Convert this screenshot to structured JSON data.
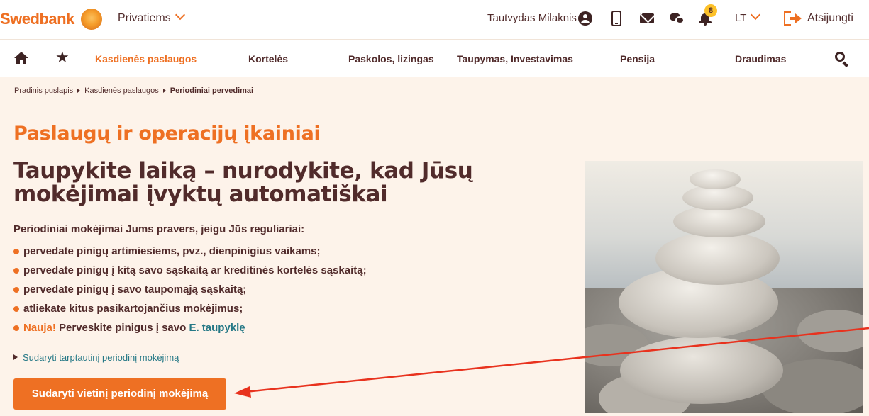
{
  "topbar": {
    "logo": "Swedbank",
    "segment": "Privatiems",
    "user_name": "Tautvydas Milaknis",
    "notification_count": "8",
    "language": "LT",
    "logout_label": "Atsijungti"
  },
  "nav": {
    "items": [
      {
        "label": "Kasdienės paslaugos",
        "active": true
      },
      {
        "label": "Kortelės"
      },
      {
        "label": "Paskolos, lizingas"
      },
      {
        "label": "Taupymas, Investavimas"
      },
      {
        "label": "Pensija"
      },
      {
        "label": "Draudimas"
      }
    ]
  },
  "breadcrumb": {
    "home": "Pradinis puslapis",
    "section": "Kasdienės paslaugos",
    "current": "Periodiniai pervedimai"
  },
  "content": {
    "section_title": "Paslaugų ir operacijų įkainiai",
    "main_title": "Taupykite laiką – nurodykite, kad Jūsų mokėjimai įvyktų automatiškai",
    "intro": "Periodiniai mokėjimai Jums pravers, jeigu Jūs reguliariai:",
    "bullets": [
      "pervedate pinigų artimiesiems, pvz., dienpinigius vaikams;",
      "pervedate pinigų į kitą savo sąskaitą ar kreditinės kortelės sąskaitą;",
      "pervedate pinigų į savo taupomąją sąskaitą;",
      "atliekate kitus pasikartojančius mokėjimus;"
    ],
    "new_label": "Nauja!",
    "new_text": " Perveskite pinigus į savo ",
    "new_link": "E. taupyklę",
    "intl_link": "Sudaryti tarptautinį periodinį mokėjimą",
    "cta": "Sudaryti vietinį periodinį mokėjimą"
  },
  "colors": {
    "brand_orange": "#ee7023",
    "text_brown": "#512b2b",
    "link_teal": "#257886",
    "page_bg": "#fdf3ea",
    "badge_yellow": "#fdc129",
    "annotation_red": "#e8321e"
  },
  "icons": [
    "sun-logo-icon",
    "chevron-down-icon",
    "user-icon",
    "phone-icon",
    "mail-icon",
    "chat-icon",
    "bell-icon",
    "logout-icon",
    "home-icon",
    "star-icon",
    "search-icon"
  ]
}
